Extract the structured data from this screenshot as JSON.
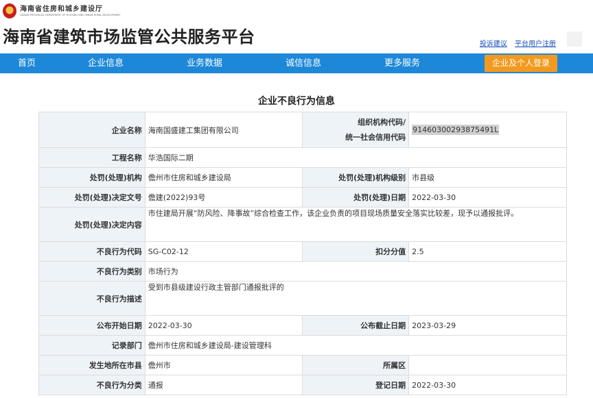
{
  "header": {
    "dept_name": "海南省住房和城乡建设厅",
    "dept_name_en": "HAINAN PROVINCIAL DEPARTMENT OF HOUSING AND URBAN-RURAL DEVELOPMENT",
    "site_title": "海南省建筑市场监管公共服务平台",
    "links": [
      "投诉建议",
      "平台用户注册"
    ],
    "emblem_icon": "national-emblem-icon"
  },
  "nav": {
    "items": [
      "首页",
      "企业信息",
      "业务数据",
      "诚信信息",
      "更多服务"
    ],
    "login": "企业及个人登录",
    "bg_color": "#1e88d8",
    "login_color": "#f29a1f"
  },
  "section_title": "企业不良行为信息",
  "labels": {
    "company_name": "企业名称",
    "org_code_1": "组织机构代码/",
    "org_code_2": "统一社会信用代码",
    "project_name": "工程名称",
    "penalty_org": "处罚(处理)机构",
    "penalty_org_level": "处罚(处理)机构级别",
    "decision_no": "处罚(处理)决定文号",
    "penalty_date": "处罚(处理)日期",
    "decision_content": "处罚(处理)决定内容",
    "behavior_code": "不良行为代码",
    "deduct_score": "扣分分值",
    "behavior_type": "不良行为类别",
    "behavior_desc": "不良行为描述",
    "publish_start": "公布开始日期",
    "publish_end": "公布截止日期",
    "record_dept": "记录部门",
    "occur_city": "发生地所在市县",
    "district": "所属区",
    "behavior_class": "不良行为分类",
    "register_date": "登记日期"
  },
  "values": {
    "company_name": "海南国盛建工集团有限公司",
    "org_code": "91460300293875491L",
    "project_name": "华浩国际二期",
    "penalty_org": "儋州市住房和城乡建设局",
    "penalty_org_level": "市县级",
    "decision_no": "儋建(2022)93号",
    "penalty_date": "2022-03-30",
    "decision_content": "市住建局开展“防风险、降事故”综合检查工作，该企业负责的项目现场质量安全落实比较差，现予以通报批评。",
    "behavior_code": "SG-C02-12",
    "deduct_score": "2.5",
    "behavior_type": "市场行为",
    "behavior_desc": "受到市县级建设行政主管部门通报批评的",
    "publish_start": "2022-03-30",
    "publish_end": "2023-03-29",
    "record_dept": "儋州市住房和城乡建设局-建设管理科",
    "occur_city": "儋州市",
    "district": "",
    "behavior_class": "通报",
    "register_date": "2022-03-30"
  }
}
